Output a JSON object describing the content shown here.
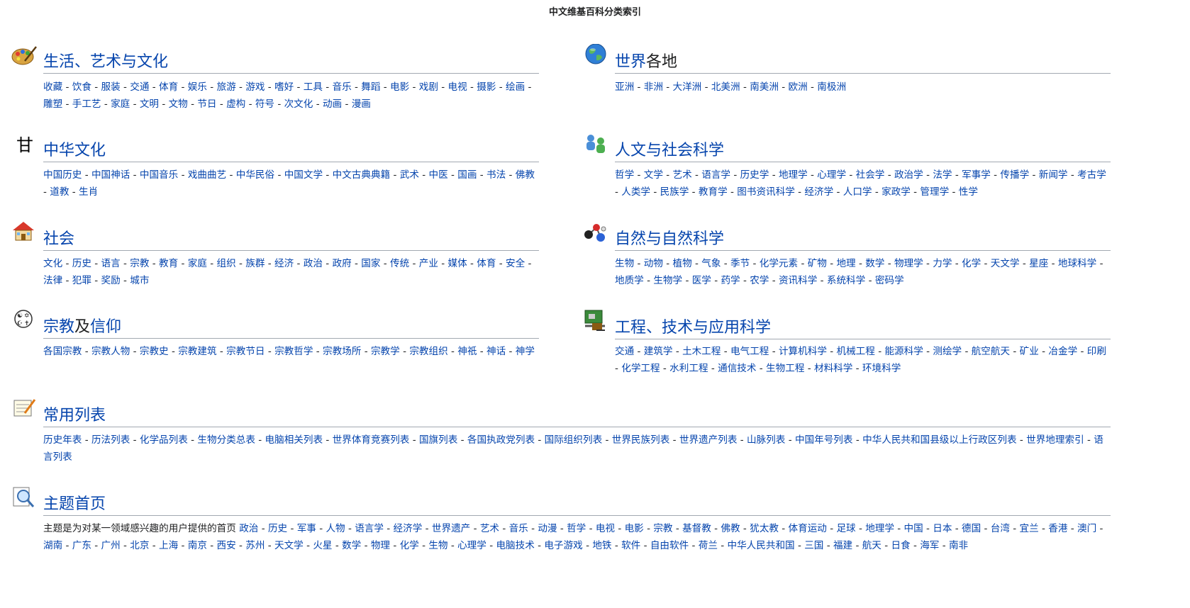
{
  "page_title": "中文维基百科分类索引",
  "sections": [
    {
      "id": "life",
      "icon": "palette-icon",
      "title": "生活、艺术与文化",
      "links": [
        "收藏",
        "饮食",
        "服装",
        "交通",
        "体育",
        "娱乐",
        "旅游",
        "游戏",
        "嗜好",
        "工具",
        "音乐",
        "舞蹈",
        "电影",
        "戏剧",
        "电视",
        "摄影",
        "绘画",
        "雕塑",
        "手工艺",
        "家庭",
        "文明",
        "文物",
        "节日",
        "虚构",
        "符号",
        "次文化",
        "动画",
        "漫画"
      ]
    },
    {
      "id": "world",
      "icon": "globe-icon",
      "title_parts": [
        "世界",
        "各地"
      ],
      "links": [
        "亚洲",
        "非洲",
        "大洋洲",
        "北美洲",
        "南美洲",
        "欧洲",
        "南极洲"
      ]
    },
    {
      "id": "chinese-culture",
      "icon": "seal-script-icon",
      "title": "中华文化",
      "links": [
        "中国历史",
        "中国神话",
        "中国音乐",
        "戏曲曲艺",
        "中华民俗",
        "中国文学",
        "中文古典典籍",
        "武术",
        "中医",
        "国画",
        "书法",
        "佛教",
        "道教",
        "生肖"
      ]
    },
    {
      "id": "humanities",
      "icon": "people-icon",
      "title": "人文与社会科学",
      "links": [
        "哲学",
        "文学",
        "艺术",
        "语言学",
        "历史学",
        "地理学",
        "心理学",
        "社会学",
        "政治学",
        "法学",
        "军事学",
        "传播学",
        "新闻学",
        "考古学",
        "人类学",
        "民族学",
        "教育学",
        "图书资讯科学",
        "经济学",
        "人口学",
        "家政学",
        "管理学",
        "性学"
      ]
    },
    {
      "id": "society",
      "icon": "house-icon",
      "title": "社会",
      "links": [
        "文化",
        "历史",
        "语言",
        "宗教",
        "教育",
        "家庭",
        "组织",
        "族群",
        "经济",
        "政治",
        "政府",
        "国家",
        "传统",
        "产业",
        "媒体",
        "体育",
        "安全",
        "法律",
        "犯罪",
        "奖励",
        "城市"
      ]
    },
    {
      "id": "nature",
      "icon": "molecule-icon",
      "title": "自然与自然科学",
      "links": [
        "生物",
        "动物",
        "植物",
        "气象",
        "季节",
        "化学元素",
        "矿物",
        "地理",
        "数学",
        "物理学",
        "力学",
        "化学",
        "天文学",
        "星座",
        "地球科学",
        "地质学",
        "生物学",
        "医学",
        "药学",
        "农学",
        "资讯科学",
        "系统科学",
        "密码学"
      ]
    },
    {
      "id": "religion",
      "icon": "religion-symbols-icon",
      "title_parts": [
        "宗教",
        "及",
        "信仰"
      ],
      "links": [
        "各国宗教",
        "宗教人物",
        "宗教史",
        "宗教建筑",
        "宗教节日",
        "宗教哲学",
        "宗教场所",
        "宗教学",
        "宗教组织",
        "神祇",
        "神话",
        "神学"
      ]
    },
    {
      "id": "engineering",
      "icon": "circuit-board-icon",
      "title": "工程、技术与应用科学",
      "links": [
        "交通",
        "建筑学",
        "土木工程",
        "电气工程",
        "计算机科学",
        "机械工程",
        "能源科学",
        "测绘学",
        "航空航天",
        "矿业",
        "冶金学",
        "印刷",
        "化学工程",
        "水利工程",
        "通信技术",
        "生物工程",
        "材料科学",
        "环境科学"
      ]
    },
    {
      "id": "lists",
      "icon": "notepad-icon",
      "title": "常用列表",
      "links": [
        "历史年表",
        "历法列表",
        "化学品列表",
        "生物分类总表",
        "电脑相关列表",
        "世界体育竞赛列表",
        "国旗列表",
        "各国执政党列表",
        "国际组织列表",
        "世界民族列表",
        "世界遗产列表",
        "山脉列表",
        "中国年号列表",
        "中华人民共和国县级以上行政区列表",
        "世界地理索引",
        "语言列表"
      ]
    },
    {
      "id": "portals",
      "icon": "magnifier-icon",
      "title": "主题首页",
      "intro": "主题是为对某一领域感兴趣的用户提供的首页",
      "links": [
        "政治",
        "历史",
        "军事",
        "人物",
        "语言学",
        "经济学",
        "世界遗产",
        "艺术",
        "音乐",
        "动漫",
        "哲学",
        "电视",
        "电影",
        "宗教",
        "基督教",
        "佛教",
        "犹太教",
        "体育运动",
        "足球",
        "地理学",
        "中国",
        "日本",
        "德国",
        "台湾",
        "宜兰",
        "香港",
        "澳门",
        "湖南",
        "广东",
        "广州",
        "北京",
        "上海",
        "南京",
        "西安",
        "苏州",
        "天文学",
        "火星",
        "数学",
        "物理",
        "化学",
        "生物",
        "心理学",
        "电脑技术",
        "电子游戏",
        "地铁",
        "软件",
        "自由软件",
        "荷兰",
        "中华人民共和国",
        "三国",
        "福建",
        "航天",
        "日食",
        "海军",
        "南非"
      ]
    }
  ],
  "separator": " - "
}
